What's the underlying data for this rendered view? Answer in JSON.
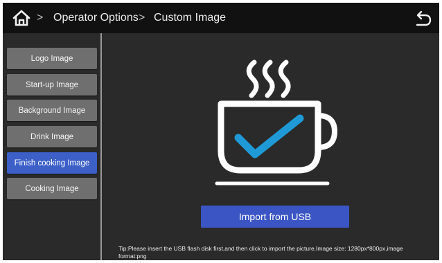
{
  "header": {
    "home_icon": "home-icon",
    "breadcrumb": [
      "Operator Options",
      "Custom Image"
    ],
    "separator": ">",
    "back_icon": "back-arrow-icon"
  },
  "sidebar": {
    "items": [
      {
        "label": "Logo Image",
        "active": false
      },
      {
        "label": "Start-up Image",
        "active": false
      },
      {
        "label": "Background Image",
        "active": false
      },
      {
        "label": "Drink Image",
        "active": false
      },
      {
        "label": "Finish cooking Image",
        "active": true
      },
      {
        "label": "Cooking Image",
        "active": false
      }
    ]
  },
  "main": {
    "preview_icon": "coffee-cup-checkmark-icon",
    "import_button": "Import from USB",
    "tip": "Tip:Please insert the USB flash disk first,and then click to import the picture.Image size: 1280px*800px,image format:png"
  },
  "colors": {
    "accent": "#3b55c4",
    "active_item": "#3c5fc8",
    "inactive_item": "#6f6f6f",
    "check": "#1f9ad6",
    "background": "#2a2a2a",
    "header": "#111111"
  }
}
